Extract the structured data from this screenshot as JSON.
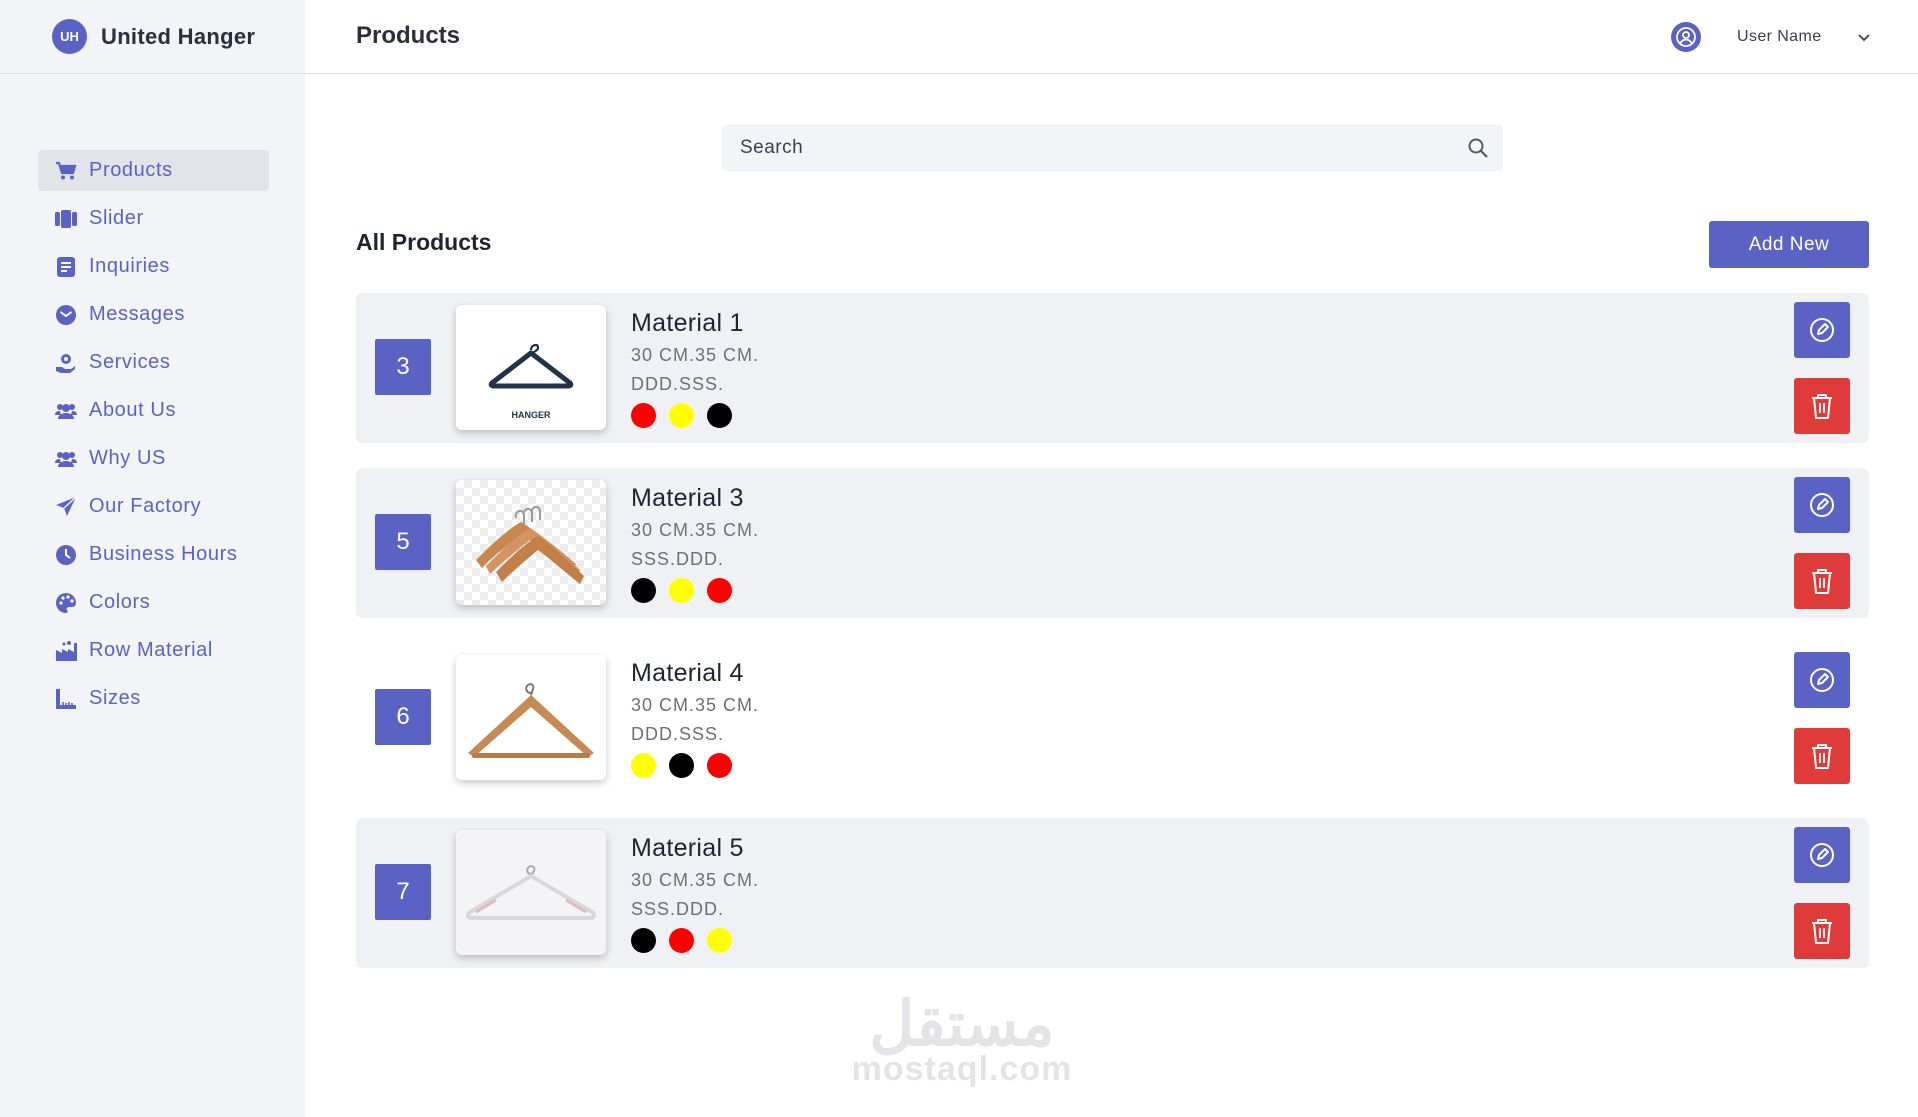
{
  "brand": {
    "logo_text": "UH",
    "name": "United Hanger"
  },
  "header": {
    "title": "Products",
    "user_name": "User Name"
  },
  "sidebar": {
    "items": [
      {
        "label": "Products",
        "icon": "cart-icon",
        "active": true
      },
      {
        "label": "Slider",
        "icon": "slider-icon"
      },
      {
        "label": "Inquiries",
        "icon": "document-icon"
      },
      {
        "label": "Messages",
        "icon": "message-icon"
      },
      {
        "label": "Services",
        "icon": "hand-gear-icon"
      },
      {
        "label": "About Us",
        "icon": "users-icon"
      },
      {
        "label": "Why US",
        "icon": "users-icon"
      },
      {
        "label": "Our Factory",
        "icon": "paper-plane-icon"
      },
      {
        "label": "Business Hours",
        "icon": "clock-icon"
      },
      {
        "label": "Colors",
        "icon": "palette-icon"
      },
      {
        "label": "Row Material",
        "icon": "factory-icon"
      },
      {
        "label": "Sizes",
        "icon": "ruler-icon"
      }
    ]
  },
  "search": {
    "placeholder": "Search"
  },
  "main": {
    "section_title": "All Products",
    "add_label": "Add New",
    "products": [
      {
        "number": "3",
        "name": "Material 1",
        "size": "30 CM.35 CM.",
        "code": "DDD.SSS.",
        "image": "black hanger logo",
        "image_label": "HANGER",
        "colors": [
          "#ff0000",
          "#ffff00",
          "#000000"
        ]
      },
      {
        "number": "5",
        "name": "Material 3",
        "size": "30 CM.35 CM.",
        "code": "SSS.DDD.",
        "image": "wooden hangers",
        "colors": [
          "#000000",
          "#ffff00",
          "#ff0000"
        ]
      },
      {
        "number": "6",
        "name": "Material 4",
        "size": "30 CM.35 CM.",
        "code": "DDD.SSS.",
        "image": "wooden hanger with bar",
        "colors": [
          "#ffff00",
          "#000000",
          "#ff0000"
        ]
      },
      {
        "number": "7",
        "name": "Material 5",
        "size": "30 CM.35 CM.",
        "code": "SSS.DDD.",
        "image": "white hanger",
        "colors": [
          "#000000",
          "#ff0000",
          "#ffff00"
        ]
      }
    ]
  },
  "watermark": {
    "arabic": "مستقل",
    "latin": "mostaql.com"
  },
  "colors": {
    "accent": "#5a63c4",
    "danger": "#e03b3b",
    "sidebar_bg": "#f3f4f8",
    "card_bg": "#f0f1f5"
  }
}
